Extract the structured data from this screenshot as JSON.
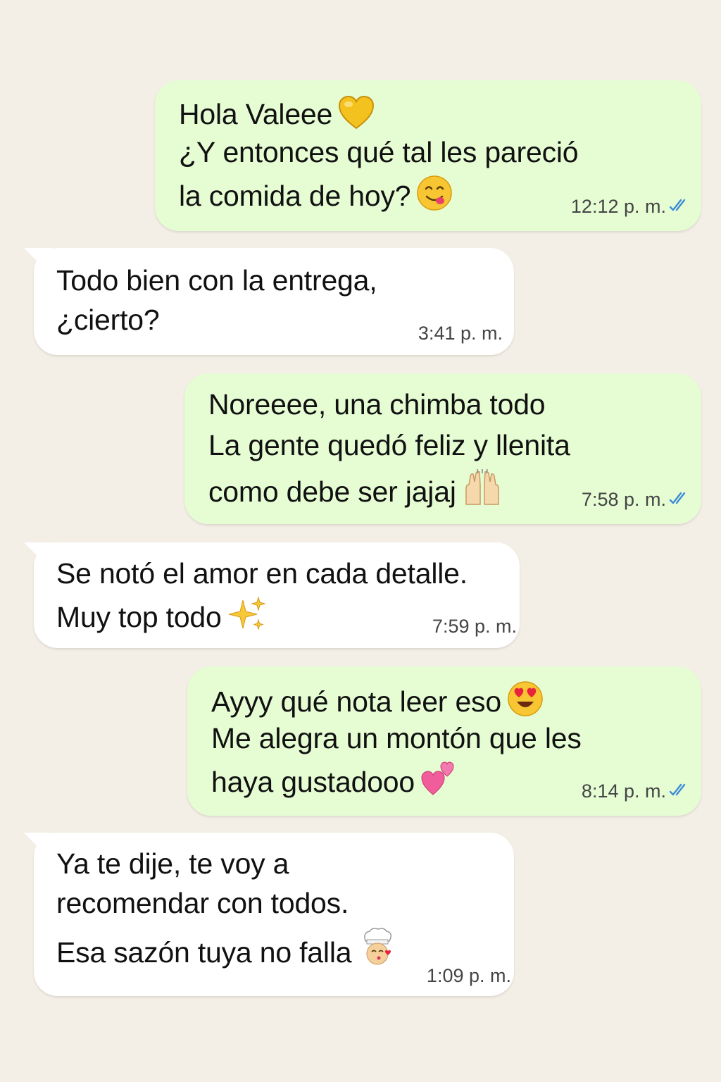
{
  "theme": {
    "background": "#f4efe6",
    "outgoing_bubble": "#e6fdd4",
    "incoming_bubble": "#ffffff",
    "read_ticks": "#3b8cd6"
  },
  "messages": [
    {
      "direction": "outgoing",
      "lines": [
        "Hola Valeee",
        "¿Y entonces qué tal les pareció",
        "la comida de hoy?"
      ],
      "emojis": [
        "yellow-heart-emoji",
        "yum-face-emoji"
      ],
      "time": "12:12 p. m.",
      "status": "read"
    },
    {
      "direction": "incoming",
      "lines": [
        "Todo bien con la entrega,",
        "¿cierto?"
      ],
      "time": "3:41 p. m."
    },
    {
      "direction": "outgoing",
      "lines": [
        "Noreeee, una chimba todo",
        "La gente quedó feliz y llenita",
        "como debe ser jajaj"
      ],
      "emojis": [
        "raising-hands-emoji"
      ],
      "time": "7:58 p. m.",
      "status": "read"
    },
    {
      "direction": "incoming",
      "lines": [
        "Se notó el amor en cada detalle.",
        "Muy top todo"
      ],
      "emojis": [
        "sparkles-emoji"
      ],
      "time": "7:59 p. m."
    },
    {
      "direction": "outgoing",
      "lines": [
        "Ayyy qué nota leer eso",
        "Me alegra un montón que les",
        "haya gustadooo"
      ],
      "emojis": [
        "heart-eyes-face-emoji",
        "two-hearts-emoji"
      ],
      "time": "8:14 p. m.",
      "status": "read"
    },
    {
      "direction": "incoming",
      "lines": [
        "Ya te dije, te voy a",
        "recomendar con todos.",
        "Esa sazón tuya no falla"
      ],
      "emojis": [
        "chef-kiss-emoji"
      ],
      "time": "1:09 p. m."
    }
  ]
}
